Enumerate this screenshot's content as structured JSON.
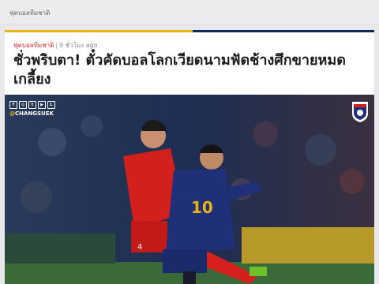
{
  "breadcrumb": "ฟุตบอลทีมชาติ",
  "article": {
    "category": "ฟุตบอลทีมชาติ",
    "separator": "|",
    "time_ago": "9 ชั่วโมง ago",
    "headline": "ชั่วพริบตา! ตั๋วคัดบอลโลกเวียดนามฟัดช้างศึกขายหมดเกลี้ยง"
  },
  "photo": {
    "handle_prefix": "@",
    "handle": "CHANGSUEK",
    "social_icons": [
      "facebook-icon",
      "instagram-icon",
      "twitter-icon",
      "youtube-icon",
      "line-icon"
    ],
    "jersey_numbers": [
      "10",
      "4"
    ]
  },
  "colors": {
    "accent_gold": "#e7b416",
    "accent_navy": "#0b2a5b",
    "category_red": "#e12c31"
  }
}
